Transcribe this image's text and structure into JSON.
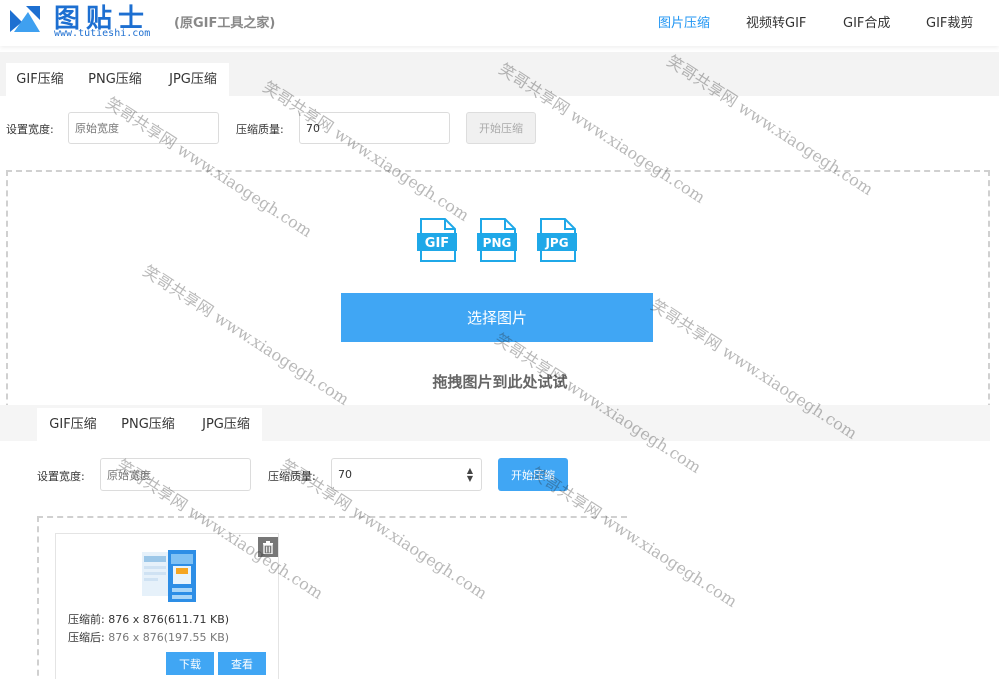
{
  "header": {
    "logo_title": "图贴士",
    "logo_url": "www.tutieshi.com",
    "logo_subtitle": "(原GIF工具之家)",
    "nav": [
      {
        "label": "图片压缩",
        "active": true
      },
      {
        "label": "视频转GIF",
        "active": false
      },
      {
        "label": "GIF合成",
        "active": false
      },
      {
        "label": "GIF裁剪",
        "active": false
      }
    ]
  },
  "panel1": {
    "tabs": [
      "GIF压缩",
      "PNG压缩",
      "JPG压缩"
    ],
    "width_label": "设置宽度:",
    "width_placeholder": "原始宽度",
    "quality_label": "压缩质量:",
    "quality_value": "70",
    "start_button": "开始压缩",
    "file_icons": [
      "GIF",
      "PNG",
      "JPG"
    ],
    "select_button": "选择图片",
    "drag_hint": "拖拽图片到此处试试"
  },
  "panel2": {
    "tabs": [
      "GIF压缩",
      "PNG压缩",
      "JPG压缩"
    ],
    "width_label": "设置宽度:",
    "width_placeholder": "原始宽度",
    "quality_label": "压缩质量:",
    "quality_value": "70",
    "start_button": "开始压缩",
    "result": {
      "before_label": "压缩前:",
      "before_value": "876 x 876(611.71 KB)",
      "after_label": "压缩后:",
      "after_value": "876 x 876(197.55 KB)",
      "download_button": "下载",
      "view_button": "查看",
      "trash_icon": "trash-icon"
    }
  },
  "watermark": {
    "text_cn": "笑哥共享网",
    "text_url": "www.xiaogegh.com"
  },
  "colors": {
    "accent": "#40a6f4",
    "nav_active": "#2196f3",
    "logo_blue": "#1d6fd1",
    "file_icon": "#1fa8e8"
  }
}
